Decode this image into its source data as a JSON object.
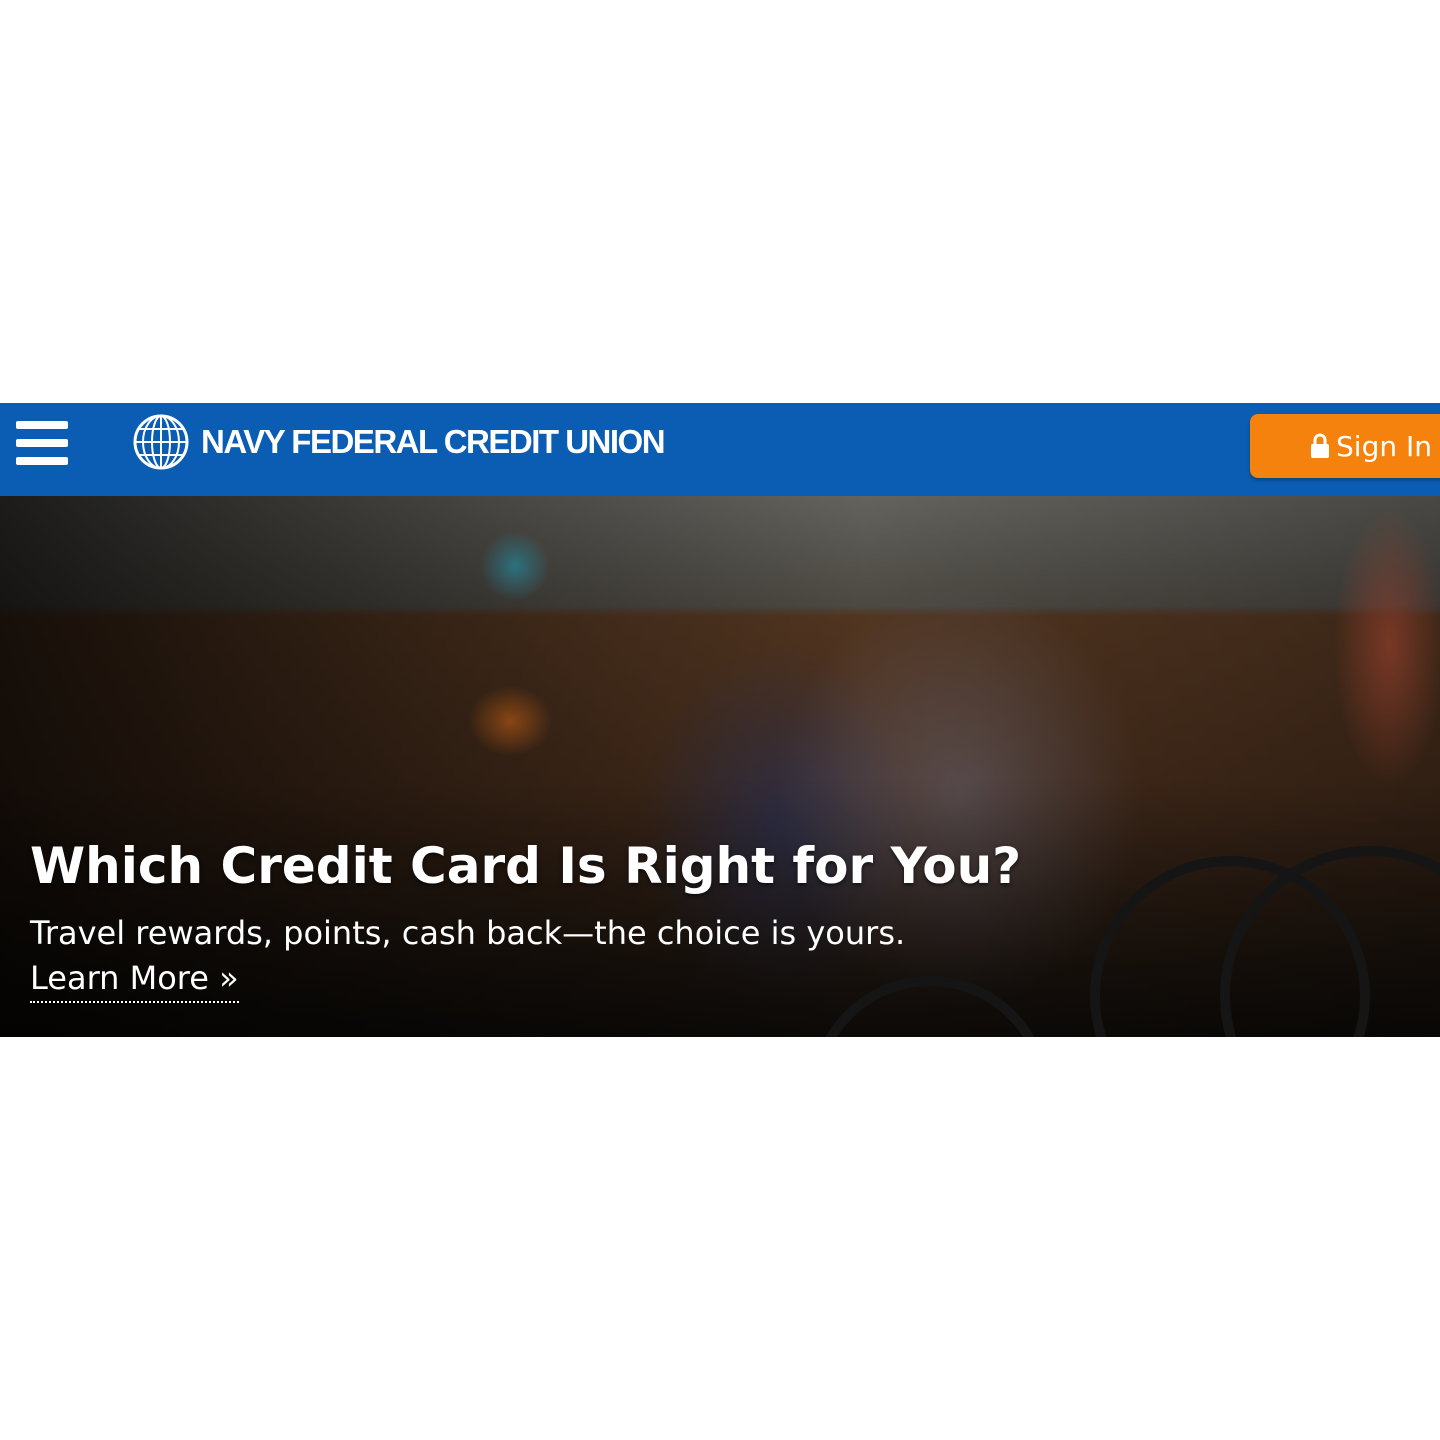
{
  "header": {
    "brand": "NAVY FEDERAL CREDIT UNION",
    "sign_in_label": "Sign In",
    "color": "#0b5db3",
    "sign_in_color": "#f5820d"
  },
  "hero": {
    "title": "Which Credit Card Is Right for You?",
    "subtitle": "Travel rewards, points, cash back—the choice is yours.",
    "link_label": "Learn More »"
  }
}
